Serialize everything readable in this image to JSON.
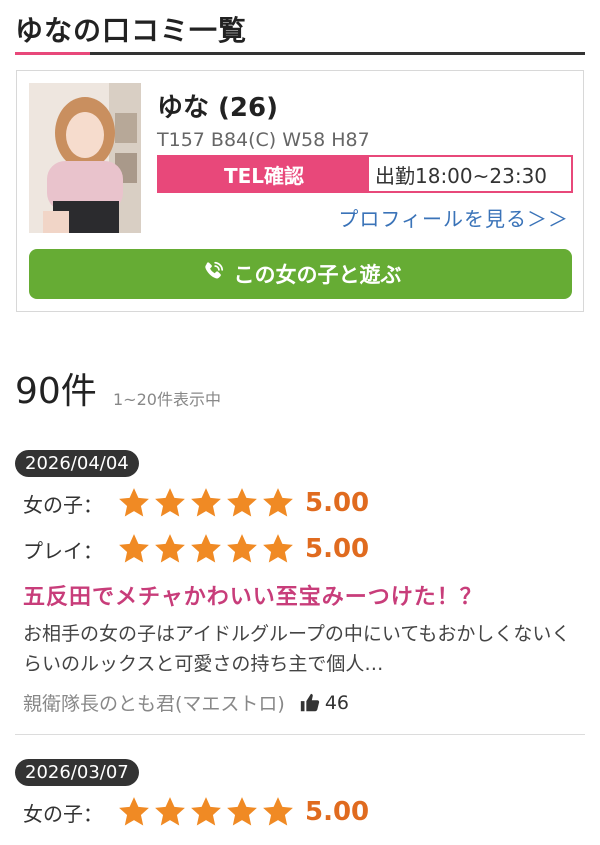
{
  "page": {
    "title": "ゆなの口コミ一覧"
  },
  "profile": {
    "name": "ゆな (26)",
    "stats": "T157 B84(C) W58 H87",
    "tel_label": "TEL確認",
    "hours": "出勤18:00~23:30",
    "profile_link": "プロフィールを見る＞＞",
    "call_label": "この女の子と遊ぶ"
  },
  "summary": {
    "count": "90件",
    "range": "1~20件表示中"
  },
  "reviews": [
    {
      "date": "2026/04/04",
      "girl_label": "女の子：",
      "girl_score": "5.00",
      "play_label": "プレイ：",
      "play_score": "5.00",
      "title": "五反田でメチャかわいい至宝みーつけた！？",
      "body": "お相手の女の子はアイドルグループの中にいてもおかしくないくらいのルックスと可愛さの持ち主で個人…",
      "author": "親衛隊長のとも君(マエストロ)",
      "likes": "46"
    },
    {
      "date": "2026/03/07",
      "girl_label": "女の子：",
      "girl_score": "5.00"
    }
  ],
  "colors": {
    "accent": "#e8487a",
    "call": "#66ac34",
    "star": "#f08a24",
    "title": "#c83d7a"
  }
}
